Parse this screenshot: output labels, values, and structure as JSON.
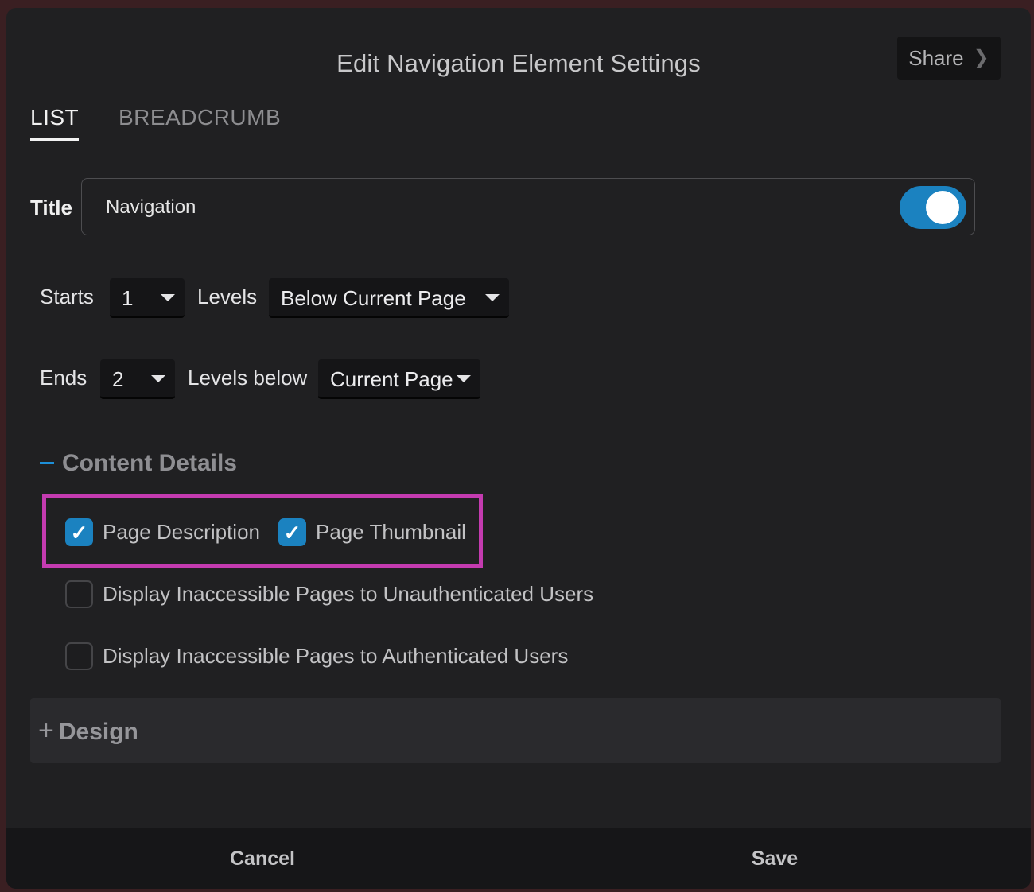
{
  "dialog": {
    "title": "Edit Navigation Element Settings",
    "share_label": "Share"
  },
  "tabs": [
    {
      "label": "LIST",
      "active": true
    },
    {
      "label": "BREADCRUMB",
      "active": false
    }
  ],
  "title_field": {
    "label": "Title",
    "value": "Navigation",
    "toggle_on": true
  },
  "starts": {
    "label": "Starts",
    "value": "1",
    "levels_label": "Levels",
    "relation": "Below Current Page"
  },
  "ends": {
    "label": "Ends",
    "value": "2",
    "levels_label": "Levels below",
    "relation": "Current Page"
  },
  "content_details": {
    "heading": "Content Details",
    "options": [
      {
        "label": "Page Description",
        "checked": true
      },
      {
        "label": "Page Thumbnail",
        "checked": true
      },
      {
        "label": "Display Inaccessible Pages to Unauthenticated Users",
        "checked": false
      },
      {
        "label": "Display Inaccessible Pages to Authenticated Users",
        "checked": false
      }
    ]
  },
  "design": {
    "heading": "Design"
  },
  "footer": {
    "cancel_label": "Cancel",
    "save_label": "Save"
  },
  "colors": {
    "accent": "#1b82c0",
    "highlight": "#c43bb0",
    "dialog_bg": "#202022"
  }
}
